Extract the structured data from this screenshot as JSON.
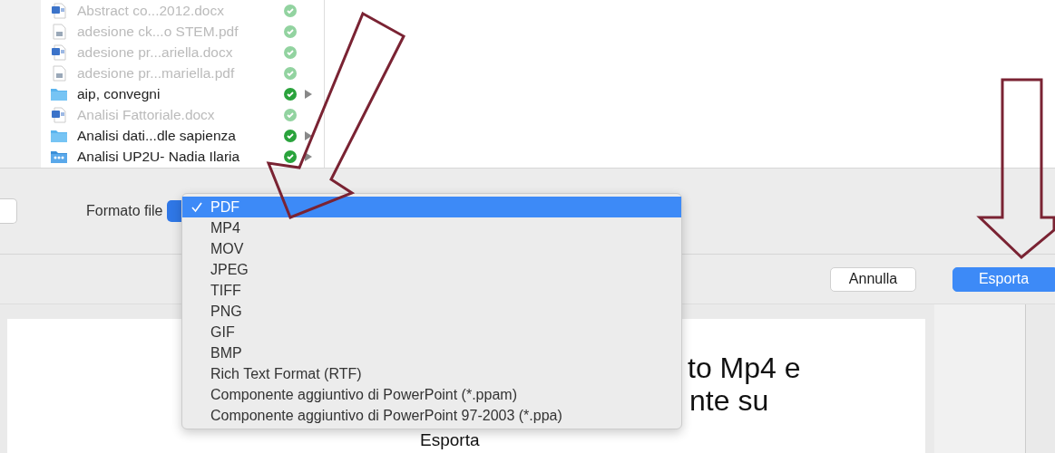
{
  "files": [
    {
      "name": "Abstract co...2012.docx",
      "kind": "word",
      "disabled": true
    },
    {
      "name": "adesione ck...o STEM.pdf",
      "kind": "pdf",
      "disabled": true
    },
    {
      "name": "adesione pr...ariella.docx",
      "kind": "word",
      "disabled": true
    },
    {
      "name": "adesione pr...mariella.pdf",
      "kind": "pdf",
      "disabled": true
    },
    {
      "name": "aip, convegni",
      "kind": "folder",
      "disabled": false
    },
    {
      "name": "Analisi  Fattoriale.docx",
      "kind": "word",
      "disabled": true
    },
    {
      "name": "Analisi dati...dle sapienza",
      "kind": "folder",
      "disabled": false
    },
    {
      "name": "Analisi UP2U- Nadia Ilaria",
      "kind": "shared-folder",
      "disabled": false
    }
  ],
  "format": {
    "label": "Formato file",
    "options": [
      {
        "label": "PDF",
        "selected": true
      },
      {
        "label": "MP4",
        "selected": false
      },
      {
        "label": "MOV",
        "selected": false
      },
      {
        "label": "JPEG",
        "selected": false
      },
      {
        "label": "TIFF",
        "selected": false
      },
      {
        "label": "PNG",
        "selected": false
      },
      {
        "label": "GIF",
        "selected": false
      },
      {
        "label": "BMP",
        "selected": false
      },
      {
        "label": "Rich Text Format (RTF)",
        "selected": false
      },
      {
        "label": "Componente aggiuntivo di PowerPoint (*.ppam)",
        "selected": false
      },
      {
        "label": "Componente aggiuntivo di PowerPoint 97-2003 (*.ppa)",
        "selected": false
      }
    ]
  },
  "buttons": [
    {
      "label": "Annulla",
      "kind": "cancel"
    },
    {
      "label": "Esporta",
      "kind": "default"
    }
  ],
  "slide_lines": [
    "to Mp4 e",
    "nte su",
    "Esporta"
  ]
}
